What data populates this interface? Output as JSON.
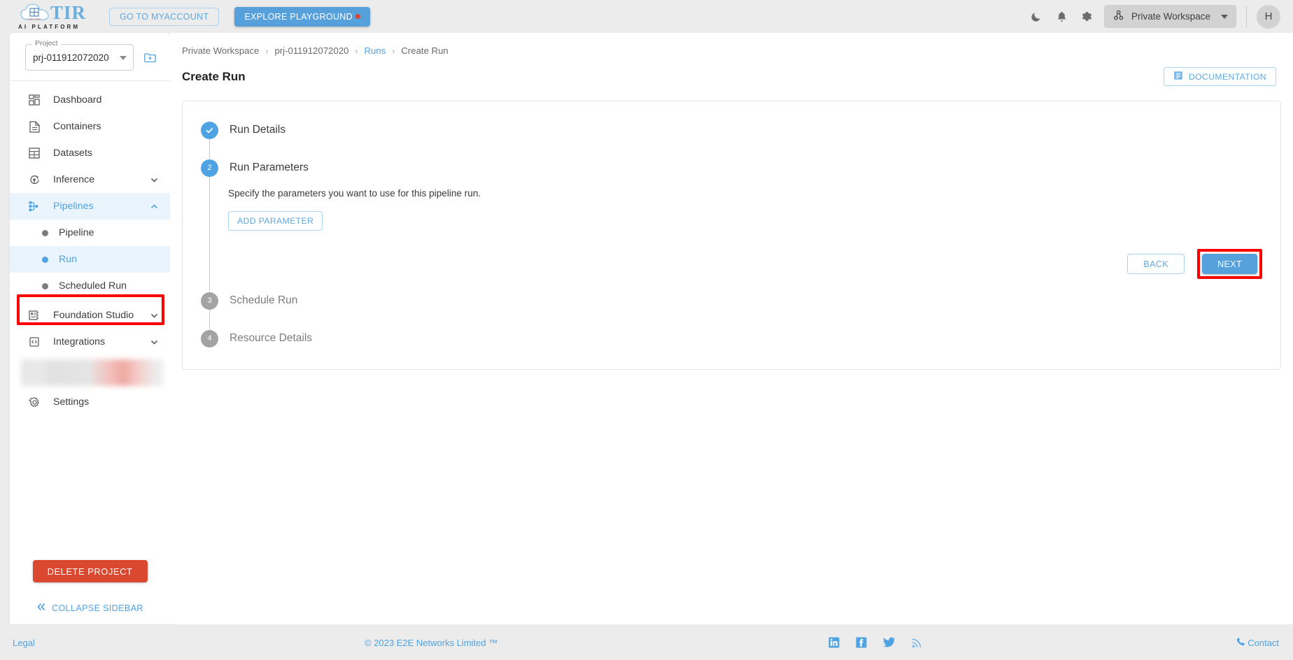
{
  "topbar": {
    "logo_text": "TIR",
    "logo_sub": "AI PLATFORM",
    "myaccount_label": "GO TO MYACCOUNT",
    "playground_label": "EXPLORE PLAYGROUND",
    "workspace_label": "Private Workspace",
    "avatar_initial": "H",
    "icons": [
      "moon-icon",
      "bell-icon",
      "gear-icon"
    ]
  },
  "sidebar": {
    "project": {
      "label": "Project",
      "value": "prj-011912072020"
    },
    "nav": [
      {
        "label": "Dashboard",
        "icon": "dashboard-icon",
        "active": false,
        "expandable": false
      },
      {
        "label": "Containers",
        "icon": "document-icon",
        "active": false,
        "expandable": false
      },
      {
        "label": "Datasets",
        "icon": "grid-icon",
        "active": false,
        "expandable": false
      },
      {
        "label": "Inference",
        "icon": "inference-icon",
        "active": false,
        "expandable": true
      },
      {
        "label": "Pipelines",
        "icon": "pipelines-icon",
        "active": true,
        "expandable": true
      }
    ],
    "sub_items": [
      {
        "label": "Pipeline",
        "active": false
      },
      {
        "label": "Run",
        "active": true
      },
      {
        "label": "Scheduled Run",
        "active": false
      }
    ],
    "nav_after": [
      {
        "label": "Foundation Studio",
        "icon": "studio-icon",
        "active": false,
        "expandable": true
      },
      {
        "label": "Integrations",
        "icon": "code-icon",
        "active": false,
        "expandable": true
      }
    ],
    "settings": {
      "label": "Settings",
      "icon": "gear-icon"
    },
    "delete_project_label": "DELETE PROJECT",
    "collapse_label": "COLLAPSE SIDEBAR"
  },
  "breadcrumb": [
    {
      "label": "Private Workspace",
      "link": false
    },
    {
      "label": "prj-011912072020",
      "link": false
    },
    {
      "label": "Runs",
      "link": true
    },
    {
      "label": "Create Run",
      "link": false
    }
  ],
  "page": {
    "title": "Create Run",
    "documentation_label": "DOCUMENTATION"
  },
  "stepper": {
    "steps": [
      {
        "number": "1",
        "label": "Run Details",
        "state": "done"
      },
      {
        "number": "2",
        "label": "Run Parameters",
        "state": "current"
      },
      {
        "number": "3",
        "label": "Schedule Run",
        "state": "todo"
      },
      {
        "number": "4",
        "label": "Resource Details",
        "state": "todo"
      }
    ],
    "description": "Specify the parameters you want to use for this pipeline run.",
    "add_parameter_label": "ADD PARAMETER",
    "back_label": "BACK",
    "next_label": "NEXT"
  },
  "footer": {
    "legal": "Legal",
    "copyright": "© 2023 E2E Networks Limited ™",
    "social": [
      "linkedin-icon",
      "facebook-icon",
      "twitter-icon",
      "rss-icon"
    ],
    "contact": "Contact"
  },
  "colors": {
    "accent": "#4fa3e3",
    "accent_button": "#56a0dc",
    "danger": "#d9482f",
    "highlight": "#fa0000",
    "page_bg": "#ececed",
    "panel_bg": "#ffffff",
    "active_nav_bg": "#e9f4fc"
  }
}
